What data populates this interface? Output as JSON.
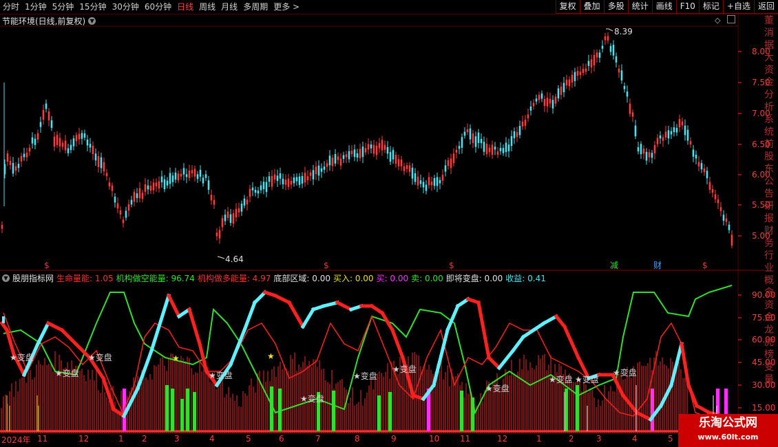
{
  "toolbar": {
    "timeframes": [
      {
        "label": "分时",
        "active": false
      },
      {
        "label": "1分钟",
        "active": false
      },
      {
        "label": "5分钟",
        "active": false
      },
      {
        "label": "15分钟",
        "active": false
      },
      {
        "label": "30分钟",
        "active": false
      },
      {
        "label": "60分钟",
        "active": false
      },
      {
        "label": "日线",
        "active": true
      },
      {
        "label": "周线",
        "active": false
      },
      {
        "label": "月线",
        "active": false
      },
      {
        "label": "多周期",
        "active": false
      },
      {
        "label": "更多 >",
        "active": false
      }
    ],
    "right_buttons": [
      "复权",
      "叠加",
      "多股",
      "统计",
      "画线",
      "F10",
      "标记",
      "+自选",
      "返回"
    ]
  },
  "main_chart": {
    "title": "节能环境(日线,前复权)",
    "y_ticks": [
      "8.00",
      "7.50",
      "7.00",
      "6.50",
      "6.00",
      "5.50",
      "5.00"
    ],
    "high_label": "8.39",
    "low_label": "4.64",
    "markers": [
      "$",
      "$",
      "$",
      "减",
      "财",
      "$"
    ]
  },
  "indicator": {
    "name": "股朋指标网",
    "readouts": [
      {
        "label": "生命量能: 1.05",
        "color": "#ff3030"
      },
      {
        "label": "机构做空能量: 96.74",
        "color": "#30e030"
      },
      {
        "label": "机构做多能量: 4.97",
        "color": "#ff3030"
      },
      {
        "label": "底部区域: 0.00",
        "color": "#e0e0e0"
      },
      {
        "label": "买入: 0.00",
        "color": "#e8e020"
      },
      {
        "label": "买: 0.00",
        "color": "#ff30ff"
      },
      {
        "label": "卖: 0.00",
        "color": "#30e030"
      },
      {
        "label": "即将变盘: 0.00",
        "color": "#e0e0e0"
      },
      {
        "label": "收益: 0.41",
        "color": "#40e8f0"
      }
    ],
    "y_ticks": [
      "90.00",
      "75.00",
      "60.00",
      "45.00",
      "30.00",
      "15.00"
    ],
    "change_label": "★变盘"
  },
  "x_axis": {
    "labels": [
      "2024年",
      "11",
      "12",
      "1",
      "2",
      "3",
      "4",
      "5",
      "6",
      "7",
      "8",
      "9",
      "10",
      "11",
      "12",
      "1",
      "2",
      "3",
      "4",
      "5"
    ]
  },
  "watermark": {
    "line1": "乐淘公式网",
    "line2": "www.60lt.com"
  },
  "colors": {
    "up": "#ff3c3c",
    "down": "#50e0f0",
    "grid": "#5a0000",
    "green": "#30e030",
    "magenta": "#ff30ff"
  }
}
